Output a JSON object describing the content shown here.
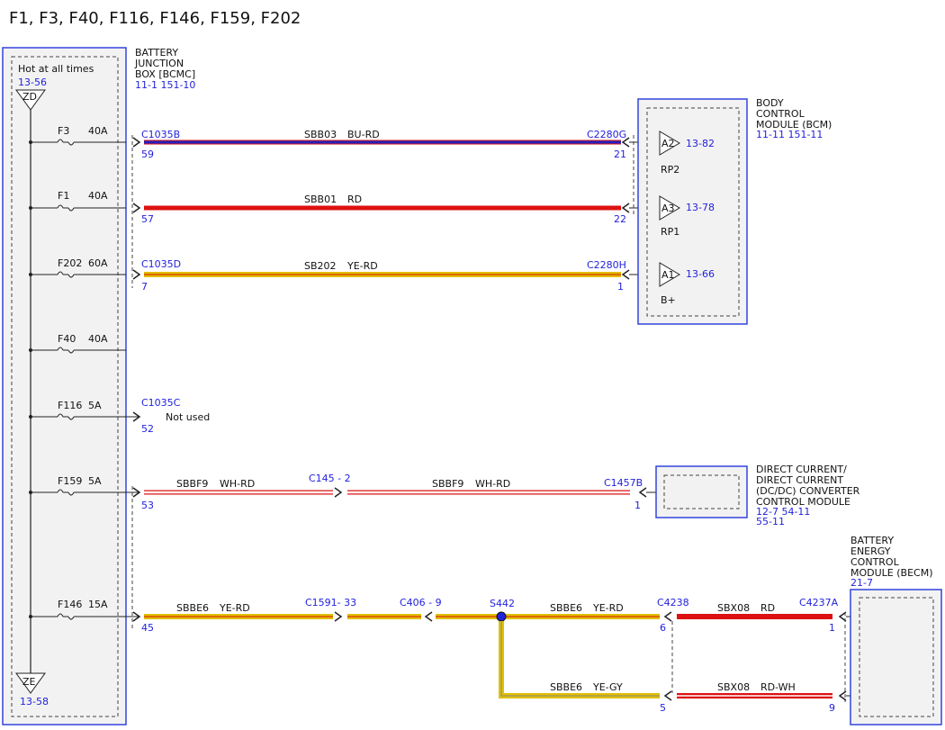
{
  "title": "F1, F3, F40, F116, F146, F159, F202",
  "bjb": {
    "name_lines": [
      "BATTERY",
      "JUNCTION",
      "BOX [BCMC]"
    ],
    "ref": "11-1   151-10",
    "hot_label": "Hot at all times",
    "hot_ref": "13-56",
    "top_ground": "ZD",
    "bottom_ground": "ZE",
    "bottom_ref": "13-58"
  },
  "fuses": [
    {
      "label": "F3",
      "rating": "40A"
    },
    {
      "label": "F1",
      "rating": "40A"
    },
    {
      "label": "F202",
      "rating": "60A"
    },
    {
      "label": "F40",
      "rating": "40A"
    },
    {
      "label": "F116",
      "rating": "5A"
    },
    {
      "label": "F159",
      "rating": "5A"
    },
    {
      "label": "F146",
      "rating": "15A"
    }
  ],
  "circuits": [
    {
      "conn": "C1035B",
      "pin": "59",
      "wire": "SBB03",
      "color_code": "BU-RD",
      "dest_conn": "C2280G",
      "dest_pin": "21"
    },
    {
      "conn": "",
      "pin": "57",
      "wire": "SBB01",
      "color_code": "RD",
      "dest_conn": "",
      "dest_pin": "22"
    },
    {
      "conn": "C1035D",
      "pin": "7",
      "wire": "SB202",
      "color_code": "YE-RD",
      "dest_conn": "C2280H",
      "dest_pin": "1"
    },
    {
      "conn": "C1035C",
      "pin": "52",
      "note": "Not used"
    },
    {
      "conn": "",
      "pin": "53",
      "wire": "SBBF9",
      "color_code": "WH-RD",
      "inline": "C145 - 2",
      "wire2": "SBBF9",
      "color_code2": "WH-RD",
      "dest_conn": "C1457B",
      "dest_pin": "1"
    },
    {
      "conn": "",
      "pin": "45",
      "wire": "SBBE6",
      "color_code": "YE-RD",
      "inline1": "C1591- 33",
      "inline2": "C406 -  9",
      "splice": "S442",
      "wire2": "SBBE6",
      "color_code2": "YE-RD",
      "dest_conn": "C4238",
      "dest_pin": "6"
    }
  ],
  "bcm": {
    "name_lines": [
      "BODY",
      "CONTROL",
      "MODULE (BCM)"
    ],
    "ref": "11-11   151-11",
    "pins": [
      {
        "pin": "A2",
        "ref": "13-82",
        "label": "RP2"
      },
      {
        "pin": "A3",
        "ref": "13-78",
        "label": "RP1"
      },
      {
        "pin": "A1",
        "ref": "13-66",
        "label": "B+"
      }
    ]
  },
  "dcdc": {
    "name_lines": [
      "DIRECT CURRENT/",
      "DIRECT CURRENT",
      "(DC/DC) CONVERTER",
      "CONTROL MODULE"
    ],
    "ref_lines": [
      "12-7   54-11",
      "55-11"
    ]
  },
  "becm": {
    "name_lines": [
      "BATTERY",
      "ENERGY",
      "CONTROL",
      "MODULE (BECM)"
    ],
    "ref": "21-7",
    "conn": "C4237A",
    "wire_top": {
      "wire": "SBX08",
      "color_code": "RD",
      "pin": "1"
    },
    "wire_bottom": {
      "wire": "SBX08",
      "color_code": "RD-WH",
      "pin": "9"
    }
  },
  "s442_branch": {
    "wire": "SBBE6",
    "color_code": "YE-GY",
    "pin": "5"
  },
  "colors": {
    "label_blue": "#2222dd",
    "box_blue": "#3344dd",
    "wire_red": "#dd1111",
    "wire_blue": "#2222bb",
    "wire_yellow": "#e0c000"
  }
}
